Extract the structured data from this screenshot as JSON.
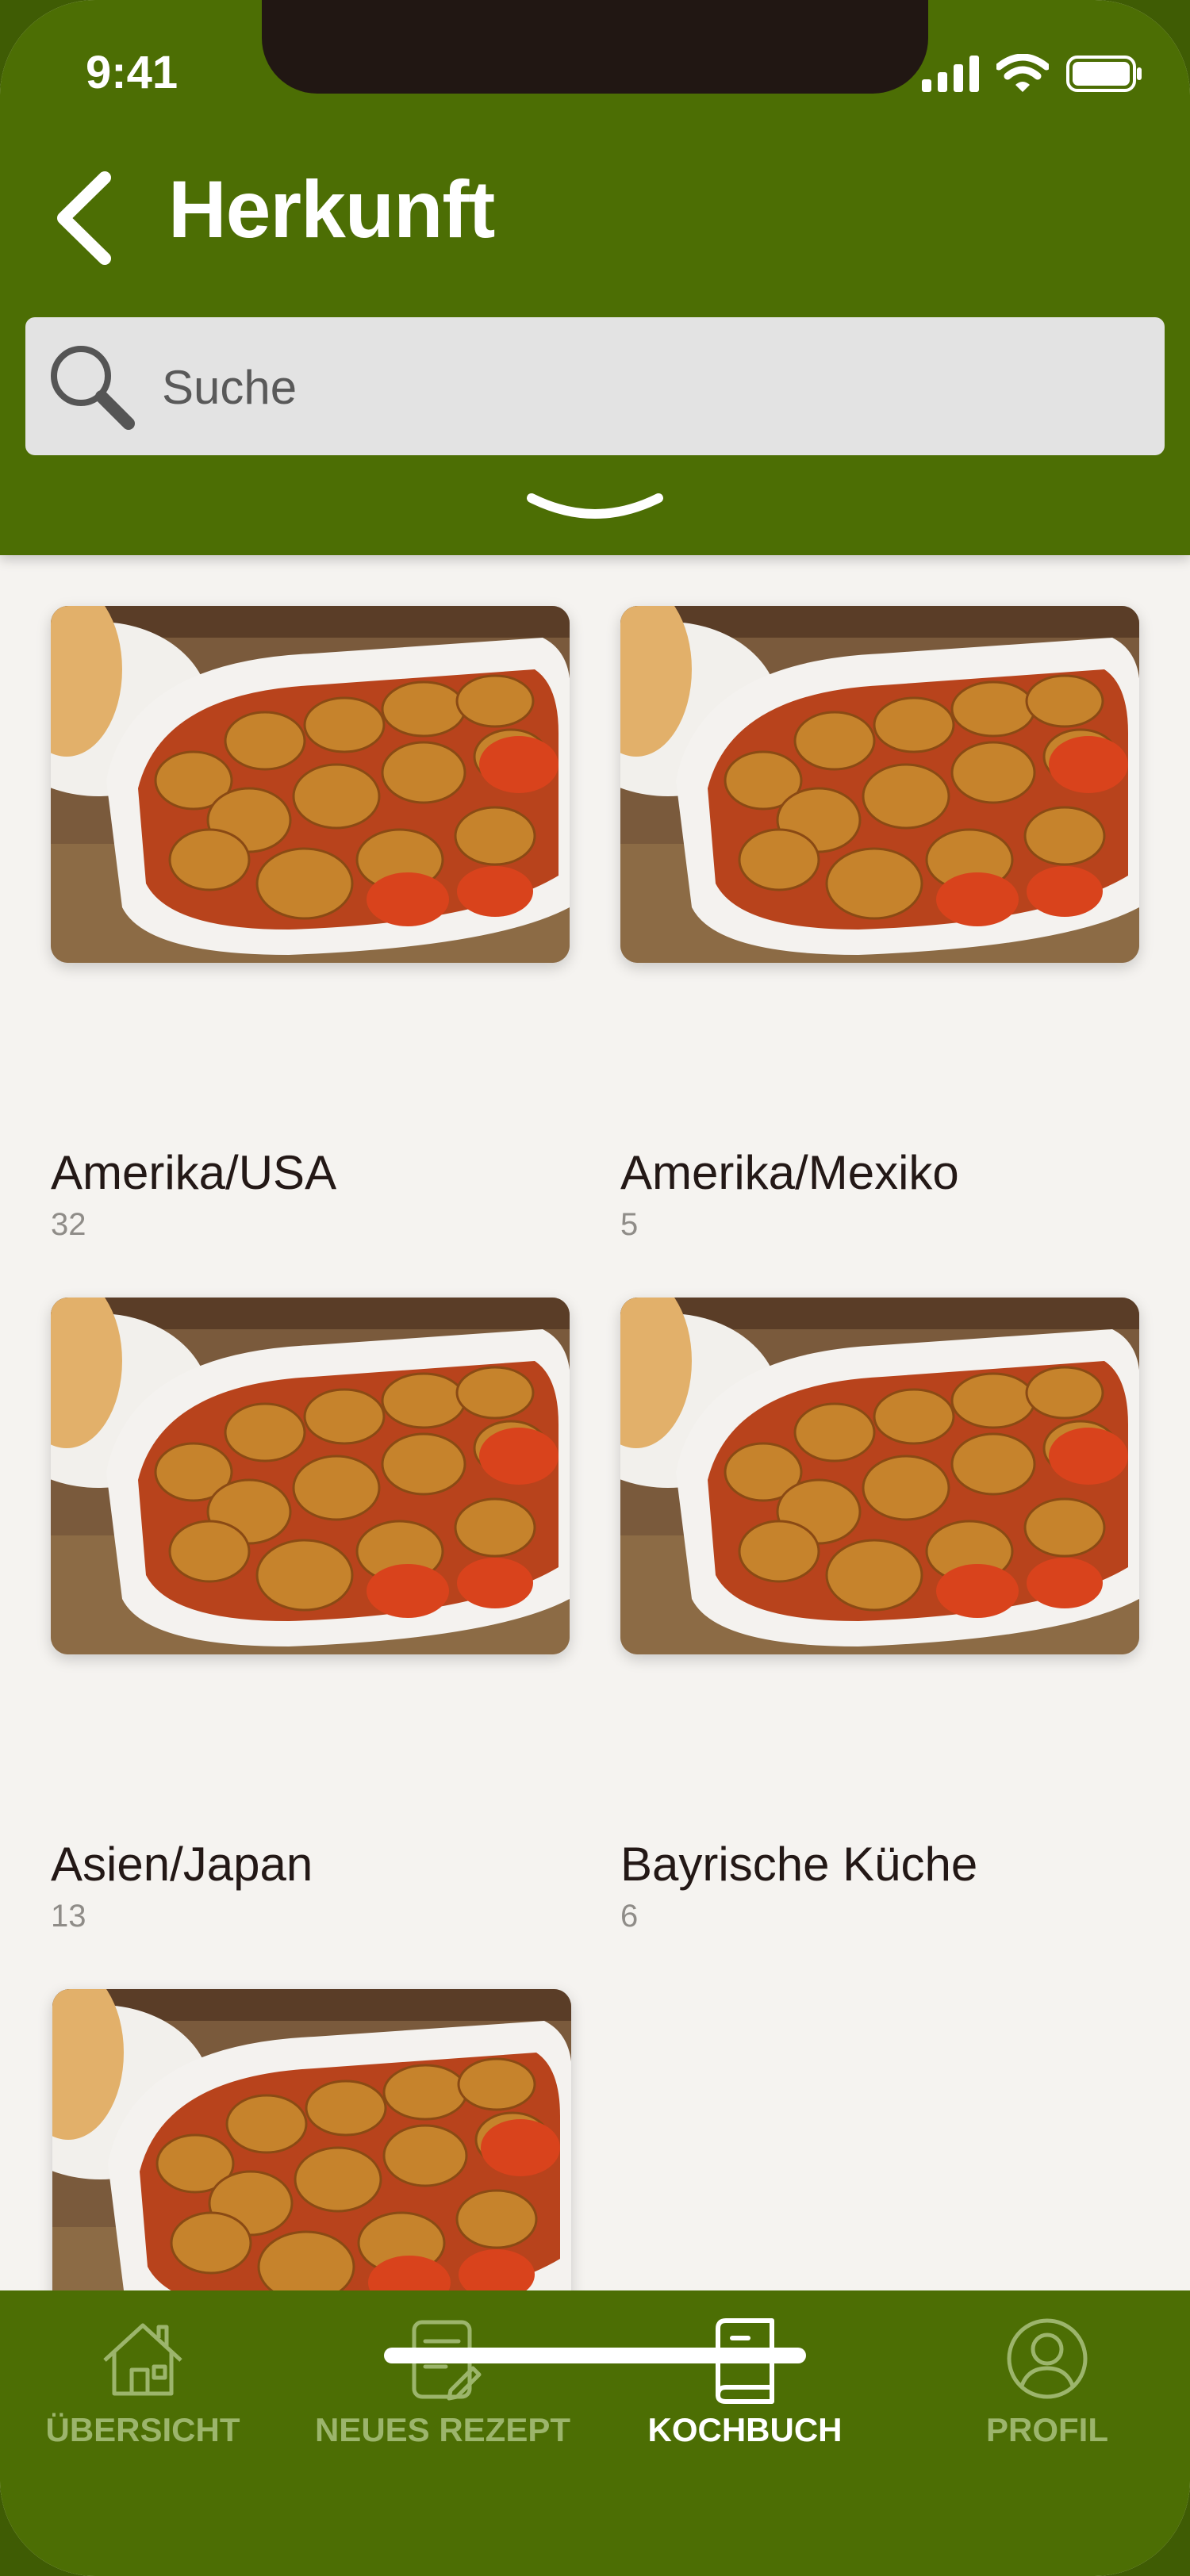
{
  "status": {
    "time": "9:41"
  },
  "header": {
    "title": "Herkunft"
  },
  "search": {
    "placeholder": "Suche"
  },
  "categories": [
    {
      "name": "Amerika/USA",
      "count": "32"
    },
    {
      "name": "Amerika/Mexiko",
      "count": "5"
    },
    {
      "name": "Asien/Japan",
      "count": "13"
    },
    {
      "name": "Bayrische Küche",
      "count": "6"
    },
    {
      "name": "",
      "count": ""
    }
  ],
  "tabs": [
    {
      "label": "ÜBERSICHT",
      "icon": "house-icon",
      "active": false
    },
    {
      "label": "NEUES REZEPT",
      "icon": "recipe-note-icon",
      "active": false
    },
    {
      "label": "KOCHBUCH",
      "icon": "book-icon",
      "active": true
    },
    {
      "label": "PROFIL",
      "icon": "user-icon",
      "active": false
    }
  ],
  "colors": {
    "header": "#4c6e04",
    "background": "#f5f3f0",
    "tab_inactive": "#9cb56c",
    "tab_active": "#ffffff"
  }
}
